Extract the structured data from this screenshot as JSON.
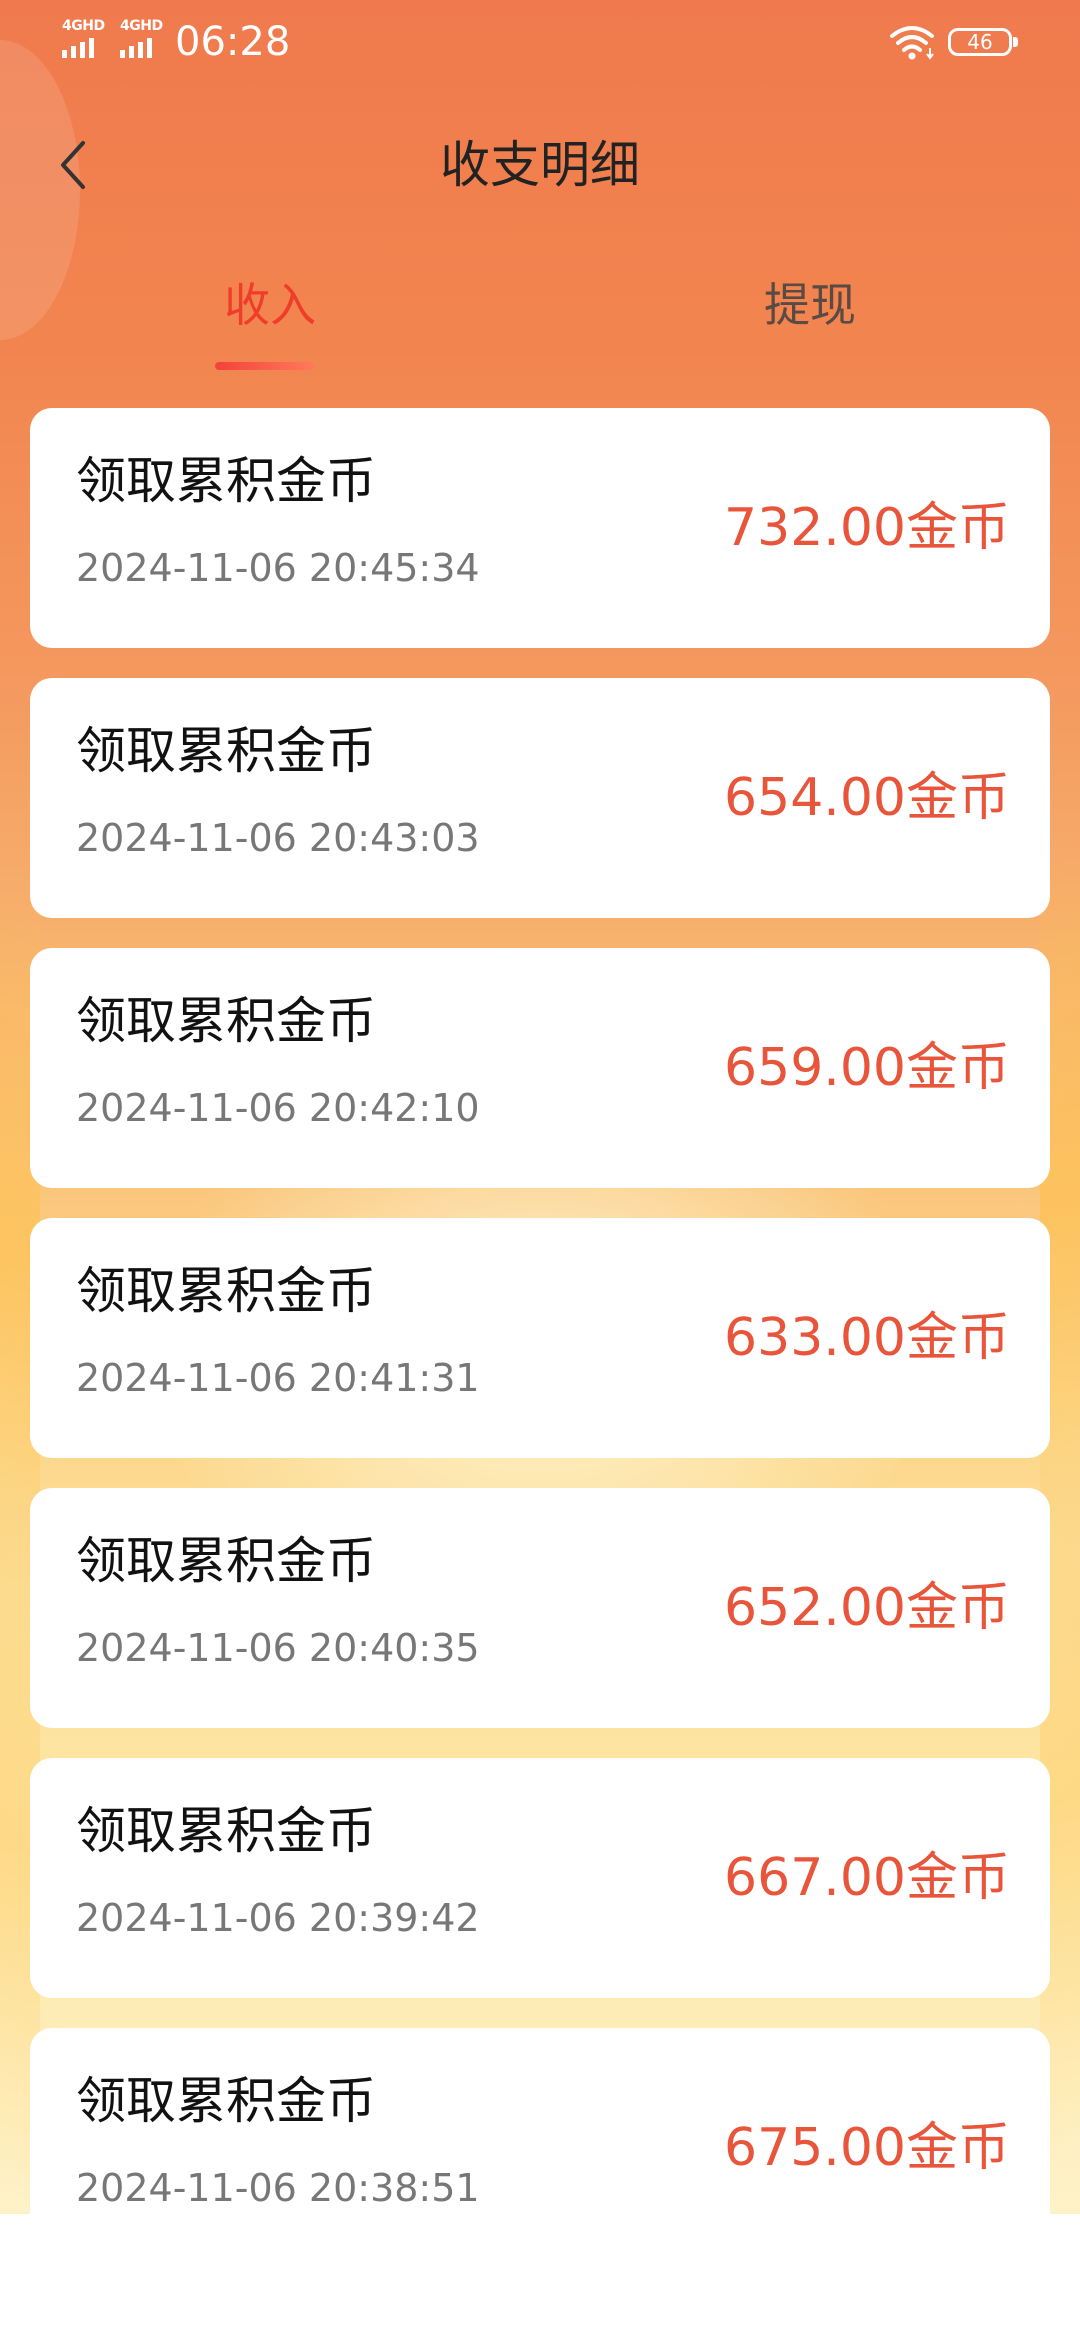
{
  "status_bar": {
    "signal_1_label": "4GHD",
    "signal_2_label": "4GHD",
    "time": "06:28",
    "battery": "46"
  },
  "nav": {
    "title": "收支明细"
  },
  "tabs": [
    {
      "label": "收入",
      "active": true
    },
    {
      "label": "提现",
      "active": false
    }
  ],
  "records": [
    {
      "title": "领取累积金币",
      "time": "2024-11-06 20:45:34",
      "amount": "732.00金币"
    },
    {
      "title": "领取累积金币",
      "time": "2024-11-06 20:43:03",
      "amount": "654.00金币"
    },
    {
      "title": "领取累积金币",
      "time": "2024-11-06 20:42:10",
      "amount": "659.00金币"
    },
    {
      "title": "领取累积金币",
      "time": "2024-11-06 20:41:31",
      "amount": "633.00金币"
    },
    {
      "title": "领取累积金币",
      "time": "2024-11-06 20:40:35",
      "amount": "652.00金币"
    },
    {
      "title": "领取累积金币",
      "time": "2024-11-06 20:39:42",
      "amount": "667.00金币"
    },
    {
      "title": "领取累积金币",
      "time": "2024-11-06 20:38:51",
      "amount": "675.00金币"
    }
  ],
  "icons": {
    "back": "chevron-left-icon",
    "wifi": "wifi-icon",
    "battery": "battery-icon",
    "signal": "signal-icon"
  },
  "colors": {
    "header_orange": "#f07a4e",
    "active_tab": "#f03d2a",
    "amount": "#e8553a"
  }
}
